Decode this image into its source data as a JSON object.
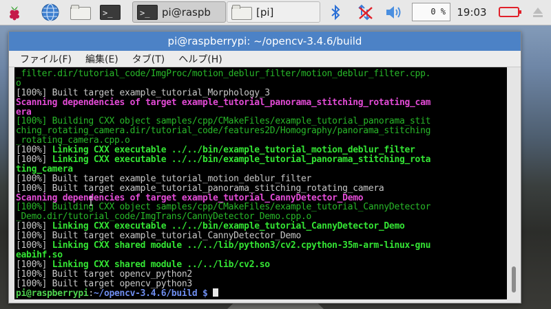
{
  "taskbar": {
    "tasks": [
      {
        "label": "pi@raspb",
        "active": true
      },
      {
        "label": "[pi]",
        "active": false
      }
    ],
    "launchers": [
      "raspberry-menu",
      "web-browser",
      "file-manager",
      "terminal"
    ],
    "cpu_usage": "0 %",
    "clock": "19:03"
  },
  "window": {
    "title": "pi@raspberrypi: ~/opencv-3.4.6/build",
    "menu": [
      "ファイル(F)",
      "編集(E)",
      "タブ(T)",
      "ヘルプ(H)"
    ]
  },
  "terminal": {
    "lines": [
      {
        "style": "green",
        "text": "_filter.dir/tutorial_code/ImgProc/motion_deblur_filter/motion_deblur_filter.cpp."
      },
      {
        "style": "green",
        "text": "o"
      },
      {
        "style": "gray",
        "text": "[100%] Built target example_tutorial_Morphology_3"
      },
      {
        "style": "mag",
        "text": "Scanning dependencies of target example_tutorial_panorama_stitching_rotating_cam"
      },
      {
        "style": "mag",
        "text": "era"
      },
      {
        "style": "green",
        "text": "[100%] Building CXX object samples/cpp/CMakeFiles/example_tutorial_panorama_stit"
      },
      {
        "style": "green",
        "text": "ching_rotating_camera.dir/tutorial_code/features2D/Homography/panorama_stitching"
      },
      {
        "style": "green",
        "text": "_rotating_camera.cpp.o"
      },
      {
        "style": "mixed",
        "prefix": "[100%] ",
        "text": "Linking CXX executable ../../bin/example_tutorial_motion_deblur_filter"
      },
      {
        "style": "mixed",
        "prefix": "[100%] ",
        "text": "Linking CXX executable ../../bin/example_tutorial_panorama_stitching_rota"
      },
      {
        "style": "bgreen",
        "text": "ting_camera"
      },
      {
        "style": "gray",
        "text": "[100%] Built target example_tutorial_motion_deblur_filter"
      },
      {
        "style": "gray",
        "text": "[100%] Built target example_tutorial_panorama_stitching_rotating_camera"
      },
      {
        "style": "mag",
        "text": "Scanning dependencies of target example_tutorial_CannyDetector_Demo"
      },
      {
        "style": "green",
        "text": "[100%] Building CXX object samples/cpp/CMakeFiles/example_tutorial_CannyDetector"
      },
      {
        "style": "green",
        "text": "_Demo.dir/tutorial_code/ImgTrans/CannyDetector_Demo.cpp.o"
      },
      {
        "style": "mixed",
        "prefix": "[100%] ",
        "text": "Linking CXX executable ../../bin/example_tutorial_CannyDetector_Demo"
      },
      {
        "style": "gray",
        "text": "[100%] Built target example_tutorial_CannyDetector_Demo"
      },
      {
        "style": "mixed",
        "prefix": "[100%] ",
        "text": "Linking CXX shared module ../../lib/python3/cv2.cpython-35m-arm-linux-gnu"
      },
      {
        "style": "bgreen",
        "text": "eabihf.so"
      },
      {
        "style": "mixed",
        "prefix": "[100%] ",
        "text": "Linking CXX shared module ../../lib/cv2.so"
      },
      {
        "style": "gray",
        "text": "[100%] Built target opencv_python2"
      },
      {
        "style": "gray",
        "text": "[100%] Built target opencv_python3"
      }
    ],
    "prompt": {
      "user": "pi@raspberrypi",
      "sep": ":",
      "path": "~/opencv-3.4.6/build",
      "symbol": " $ "
    }
  },
  "colors": {
    "titlebar": "#4c82c6",
    "text_green": "#28b829",
    "text_bright_green": "#34e534",
    "text_magenta": "#e34bd6",
    "prompt_path": "#6f8ef0"
  }
}
